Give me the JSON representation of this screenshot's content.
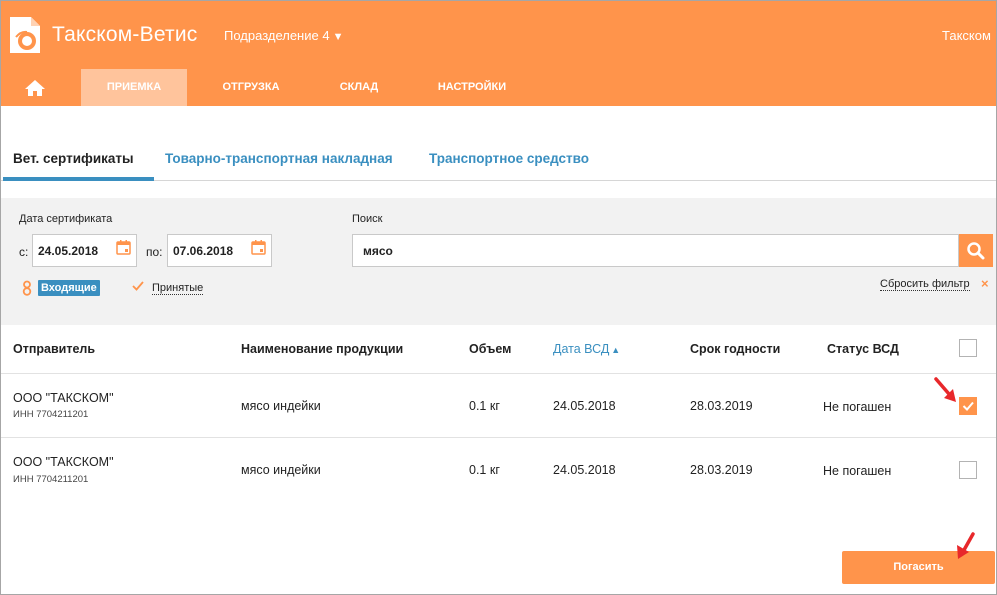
{
  "header": {
    "app_title": "Такском-Ветис",
    "division": "Подразделение 4",
    "user": "Такском"
  },
  "nav": {
    "home_icon": "home-icon",
    "items": [
      {
        "label": "ПРИЕМКА",
        "active": true
      },
      {
        "label": "ОТГРУЗКА",
        "active": false
      },
      {
        "label": "СКЛАД",
        "active": false
      },
      {
        "label": "НАСТРОЙКИ",
        "active": false
      }
    ]
  },
  "tabs": [
    {
      "label": "Вет. сертификаты",
      "active": true
    },
    {
      "label": "Товарно-транспортная накладная",
      "active": false
    },
    {
      "label": "Транспортное средство",
      "active": false
    }
  ],
  "filter": {
    "date_label": "Дата сертификата",
    "from_label": "с:",
    "from_value": "24.05.2018",
    "to_label": "по:",
    "to_value": "07.06.2018",
    "search_label": "Поиск",
    "search_value": "мясо",
    "incoming_label": "Входящие",
    "accepted_label": "Принятые",
    "reset_label": "Сбросить фильтр",
    "reset_icon": "×"
  },
  "table": {
    "columns": [
      "Отправитель",
      "Наименование продукции",
      "Объем",
      "Дата ВСД",
      "Срок годности",
      "Статус ВСД"
    ],
    "sort_column": "Дата ВСД",
    "rows": [
      {
        "sender": "ООО \"ТАКСКОМ\"",
        "inn": "ИНН 7704211201",
        "product": "мясо индейки",
        "volume": "0.1 кг",
        "vsd_date": "24.05.2018",
        "expiry": "28.03.2019",
        "status": "Не погашен",
        "checked": true
      },
      {
        "sender": "ООО \"ТАКСКОМ\"",
        "inn": "ИНН 7704211201",
        "product": "мясо индейки",
        "volume": "0.1 кг",
        "vsd_date": "24.05.2018",
        "expiry": "28.03.2019",
        "status": "Не погашен",
        "checked": false
      }
    ]
  },
  "actions": {
    "pay_label": "Погасить"
  },
  "colors": {
    "accent": "#ff944b",
    "link": "#3a8fc0",
    "arrow": "#e8282b"
  }
}
